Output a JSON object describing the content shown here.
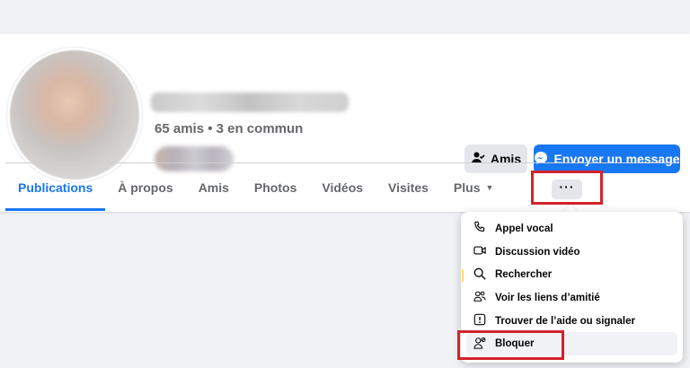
{
  "profile": {
    "friends_summary": "65 amis • 3 en commun"
  },
  "actions": {
    "friends_label": "Amis",
    "message_label": "Envoyer un message"
  },
  "tabs": [
    {
      "label": "Publications",
      "active": true
    },
    {
      "label": "À propos"
    },
    {
      "label": "Amis"
    },
    {
      "label": "Photos"
    },
    {
      "label": "Vidéos"
    },
    {
      "label": "Visites"
    },
    {
      "label": "Plus"
    }
  ],
  "more_button": {
    "label": "···"
  },
  "menu": {
    "items": [
      {
        "label": "Appel vocal",
        "icon": "phone-icon"
      },
      {
        "label": "Discussion vidéo",
        "icon": "video-camera-icon"
      },
      {
        "label": "Rechercher",
        "icon": "search-icon"
      },
      {
        "label": "Voir les liens d’amitié",
        "icon": "friends-icon"
      },
      {
        "label": "Trouver de l’aide ou signaler",
        "icon": "report-icon"
      },
      {
        "label": "Bloquer",
        "icon": "block-user-icon"
      }
    ]
  },
  "colors": {
    "accent": "#1877f2",
    "highlight": "#d3232a",
    "muted_text": "#65676b"
  }
}
